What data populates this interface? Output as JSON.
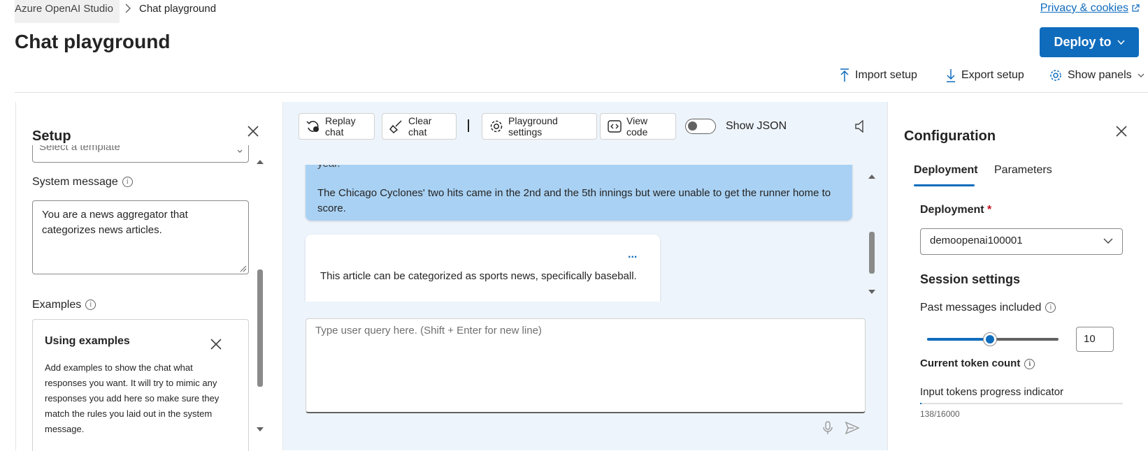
{
  "breadcrumb": {
    "root": "Azure OpenAI Studio",
    "current": "Chat playground"
  },
  "header": {
    "privacy_link": "Privacy & cookies",
    "title": "Chat playground",
    "deploy_label": "Deploy to",
    "import_label": "Import setup",
    "export_label": "Export setup",
    "panels_label": "Show panels"
  },
  "setup": {
    "title": "Setup",
    "template_placeholder": "Select a template",
    "system_message_label": "System message",
    "system_message_value": "You are a news aggregator that categorizes news articles.",
    "examples_label": "Examples",
    "using_examples_title": "Using examples",
    "using_examples_body": "Add examples to show the chat what responses you want. It will try to mimic any responses you add here so make sure they match the rules you laid out in the system message."
  },
  "chat": {
    "replay_label": "Replay chat",
    "clear_label": "Clear chat",
    "settings_label": "Playground settings",
    "view_code_label": "View code",
    "show_json_label": "Show JSON",
    "show_json_on": false,
    "user_message_tail": "year.",
    "user_message_para": "The Chicago Cyclones' two hits came in the 2nd and the 5th innings but were unable to get the runner home to score.",
    "more_actions": "...",
    "assistant_message": "This article can be categorized as sports news, specifically baseball.",
    "input_placeholder": "Type user query here. (Shift + Enter for new line)"
  },
  "config": {
    "title": "Configuration",
    "tab_deployment": "Deployment",
    "tab_parameters": "Parameters",
    "active_tab": "Deployment",
    "deployment_label": "Deployment",
    "required_mark": "*",
    "deployment_value": "demoopenai100001",
    "session_title": "Session settings",
    "past_messages_label": "Past messages included",
    "past_messages_value": "10",
    "past_messages_fraction": 0.48,
    "token_count_label": "Current token count",
    "progress_label": "Input tokens progress indicator",
    "token_count_value": "138/16000",
    "token_fraction": 0.0086
  },
  "colors": {
    "accent": "#0f6cbd",
    "user_bubble": "#a9d1f3",
    "center_bg": "#eef4fb"
  }
}
